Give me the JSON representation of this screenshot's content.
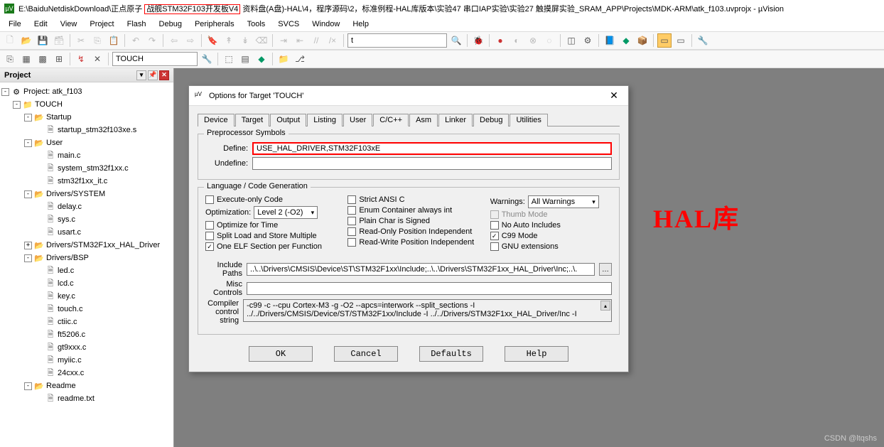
{
  "title": {
    "prefix": "E:\\BaiduNetdiskDownload\\正点原子",
    "highlight": "战舰STM32F103开发板V4",
    "suffix": "资料盘(A盘)-HAL\\4，程序源码\\2，标准例程-HAL库版本\\实验47 串口IAP实验\\实验27 触摸屏实验_SRAM_APP\\Projects\\MDK-ARM\\atk_f103.uvprojx - µVision"
  },
  "menu": [
    "File",
    "Edit",
    "View",
    "Project",
    "Flash",
    "Debug",
    "Peripherals",
    "Tools",
    "SVCS",
    "Window",
    "Help"
  ],
  "toolbar2_combo": "TOUCH",
  "project": {
    "pane_title": "Project",
    "root": "Project: atk_f103",
    "target": "TOUCH",
    "groups": [
      {
        "name": "Startup",
        "files": [
          "startup_stm32f103xe.s"
        ]
      },
      {
        "name": "User",
        "files": [
          "main.c",
          "system_stm32f1xx.c",
          "stm32f1xx_it.c"
        ]
      },
      {
        "name": "Drivers/SYSTEM",
        "files": [
          "delay.c",
          "sys.c",
          "usart.c"
        ]
      },
      {
        "name": "Drivers/STM32F1xx_HAL_Driver",
        "files": []
      },
      {
        "name": "Drivers/BSP",
        "files": [
          "led.c",
          "lcd.c",
          "key.c",
          "touch.c",
          "ctiic.c",
          "ft5206.c",
          "gt9xxx.c",
          "myiic.c",
          "24cxx.c"
        ]
      },
      {
        "name": "Readme",
        "files": [
          "readme.txt"
        ]
      }
    ]
  },
  "dialog": {
    "title": "Options for Target 'TOUCH'",
    "tabs": [
      "Device",
      "Target",
      "Output",
      "Listing",
      "User",
      "C/C++",
      "Asm",
      "Linker",
      "Debug",
      "Utilities"
    ],
    "active_tab": "C/C++",
    "preproc": {
      "group": "Preprocessor Symbols",
      "define_lbl": "Define:",
      "define_val": "USE_HAL_DRIVER,STM32F103xE",
      "undefine_lbl": "Undefine:"
    },
    "lang": {
      "group": "Language / Code Generation",
      "c1": [
        {
          "label": "Execute-only Code",
          "checked": false
        },
        {
          "label": "Optimize for Time",
          "checked": false
        },
        {
          "label": "Split Load and Store Multiple",
          "checked": false
        },
        {
          "label": "One ELF Section per Function",
          "checked": true
        }
      ],
      "opt_lbl": "Optimization:",
      "opt_val": "Level 2 (-O2)",
      "c2": [
        {
          "label": "Strict ANSI C",
          "checked": false
        },
        {
          "label": "Enum Container always int",
          "checked": false
        },
        {
          "label": "Plain Char is Signed",
          "checked": false
        },
        {
          "label": "Read-Only Position Independent",
          "checked": false
        },
        {
          "label": "Read-Write Position Independent",
          "checked": false
        }
      ],
      "warn_lbl": "Warnings:",
      "warn_val": "All Warnings",
      "c3": [
        {
          "label": "Thumb Mode",
          "checked": false,
          "disabled": true
        },
        {
          "label": "No Auto Includes",
          "checked": false
        },
        {
          "label": "C99 Mode",
          "checked": true
        },
        {
          "label": "GNU extensions",
          "checked": false
        }
      ],
      "inc_lbl": "Include Paths",
      "inc_val": "..\\..\\Drivers\\CMSIS\\Device\\ST\\STM32F1xx\\Include;..\\..\\Drivers\\STM32F1xx_HAL_Driver\\Inc;..\\.",
      "misc_lbl": "Misc Controls",
      "misc_val": "",
      "comp_lbl": "Compiler control string",
      "comp_val": "-c99 -c --cpu Cortex-M3 -g -O2 --apcs=interwork --split_sections -I ../../Drivers/CMSIS/Device/ST/STM32F1xx/Include -I ../../Drivers/STM32F1xx_HAL_Driver/Inc -I"
    },
    "buttons": [
      "OK",
      "Cancel",
      "Defaults",
      "Help"
    ]
  },
  "annotation": "HAL库",
  "watermark": "CSDN @ltqshs"
}
